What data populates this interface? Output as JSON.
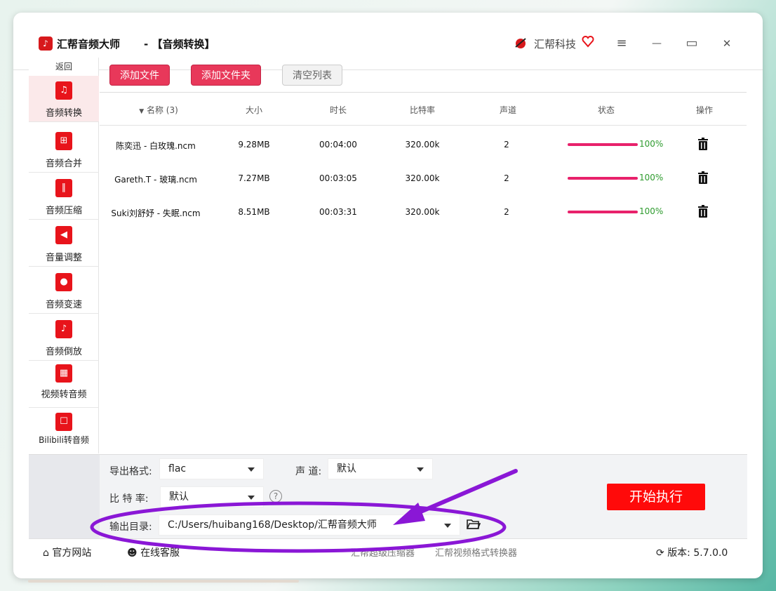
{
  "app": {
    "title": "汇帮音频大师",
    "separator": "-",
    "subtitle": "【音频转换】",
    "brand": "汇帮科技"
  },
  "window_controls": {
    "menu": "≡",
    "minimize": "—",
    "maximize": "▭",
    "close": "✕"
  },
  "sidebar": {
    "back": "返回",
    "items": [
      {
        "label": "音频转换",
        "icon": "music-convert-icon",
        "glyph": "♫",
        "active": true
      },
      {
        "label": "音频合并",
        "icon": "merge-icon",
        "glyph": "⊞",
        "active": false
      },
      {
        "label": "音频压缩",
        "icon": "waveform-icon",
        "glyph": "∥",
        "active": false
      },
      {
        "label": "音量调整",
        "icon": "volume-icon",
        "glyph": "◀",
        "active": false
      },
      {
        "label": "音频变速",
        "icon": "microphone-icon",
        "glyph": "●",
        "active": false
      },
      {
        "label": "音频倒放",
        "icon": "music-note-icon",
        "glyph": "♪",
        "active": false
      },
      {
        "label": "视频转音频",
        "icon": "film-icon",
        "glyph": "▦",
        "active": false
      },
      {
        "label": "Bilibili转音频",
        "icon": "tv-icon",
        "glyph": "☐",
        "active": false
      }
    ]
  },
  "toolbar": {
    "add_file": "添加文件",
    "add_folder": "添加文件夹",
    "clear_list": "清空列表"
  },
  "table": {
    "headers": {
      "name": "名称 (3)",
      "size": "大小",
      "duration": "时长",
      "bitrate": "比特率",
      "channels": "声道",
      "status": "状态",
      "actions": "操作"
    },
    "rows": [
      {
        "name": "陈奕迅 - 白玫瑰.ncm",
        "size": "9.28MB",
        "duration": "00:04:00",
        "bitrate": "320.00k",
        "channels": "2",
        "progress": 1.0,
        "status": "100%"
      },
      {
        "name": "Gareth.T - 玻璃.ncm",
        "size": "7.27MB",
        "duration": "00:03:05",
        "bitrate": "320.00k",
        "channels": "2",
        "progress": 1.0,
        "status": "100%"
      },
      {
        "name": "Suki刘舒妤 - 失眠.ncm",
        "size": "8.51MB",
        "duration": "00:03:31",
        "bitrate": "320.00k",
        "channels": "2",
        "progress": 1.0,
        "status": "100%"
      }
    ]
  },
  "settings": {
    "format_label": "导出格式:",
    "format_value": "flac",
    "channel_label": "声 道:",
    "channel_value": "默认",
    "bitrate_label": "比 特 率:",
    "bitrate_value": "默认",
    "help": "?",
    "output_label": "输出目录:",
    "output_value": "C:/Users/huibang168/Desktop/汇帮音频大师",
    "start": "开始执行"
  },
  "footer": {
    "website": "官方网站",
    "support": "在线客服",
    "link1": "汇帮超级压缩器",
    "link2": "汇帮视频格式转换器",
    "version": "版本: 5.7.0.0"
  },
  "colors": {
    "accent_red": "#e8385a",
    "start_red": "#ff0a0a",
    "progress": "#e8216b",
    "status_green": "#2e9b2e",
    "annotation_purple": "#8a17d6"
  }
}
